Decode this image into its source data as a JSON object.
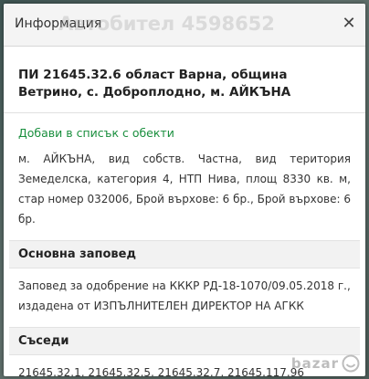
{
  "dialog": {
    "title": "Информация",
    "watermark": "Автобител 4598652",
    "close_glyph": "✕"
  },
  "parcel": {
    "title": "ПИ 21645.32.6 област Варна, община Ветрино, с. Доброплодно, м. АЙКЪНА",
    "add_link": "Добави в списък с обекти",
    "description": "м. АЙКЪНА, вид собств. Частна, вид територия Земеделска, категория 4, НТП Нива, площ 8330 кв. м, стар номер 032006, Брой върхове: 6 бр., Брой върхове: 6 бр."
  },
  "order": {
    "heading": "Основна заповед",
    "text": "Заповед за одобрение на КККР РД-18-1070/09.05.2018 г., издадена от ИЗПЪЛНИТЕЛЕН ДИРЕКТОР НА АГКК"
  },
  "neighbors": {
    "heading": "Съседи",
    "text": "21645.32.1, 21645.32.5, 21645.32.7, 21645.117.96"
  },
  "logo": {
    "text": "bazar",
    "color": "#bdbdbd"
  },
  "colors": {
    "link": "#1a8f3e",
    "header_bg": "#f4f4f4"
  }
}
